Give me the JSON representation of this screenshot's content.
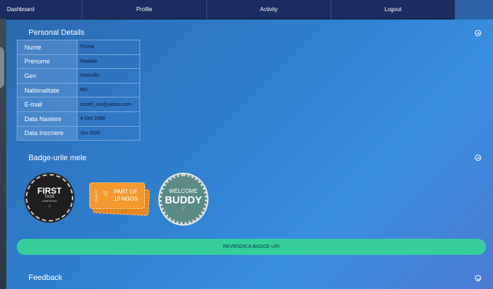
{
  "nav": {
    "items": [
      {
        "label": "Dashboard"
      },
      {
        "label": "Profile"
      },
      {
        "label": "Activity"
      },
      {
        "label": "Logout"
      }
    ]
  },
  "personal": {
    "title": "Personal Details",
    "rows": [
      {
        "key": "Nume",
        "value": "Florea"
      },
      {
        "key": "Prenume",
        "value": "Madalin"
      },
      {
        "key": "Gen",
        "value": "masculin"
      },
      {
        "key": "Nationalitate",
        "value": "RO"
      },
      {
        "key": "E-mail",
        "value": "costel_ark@yahoo.com"
      },
      {
        "key": "Data Nastere",
        "value": "4 Dec 1998"
      },
      {
        "key": "Data Inscriere",
        "value": "Jun 2020"
      }
    ]
  },
  "badges": {
    "title": "Badge-urile mele",
    "first": {
      "line1": "FIRST",
      "line2": "TASK",
      "line3": "COMPLETED"
    },
    "ngo": {
      "line1": "PART OF",
      "line2": "10 NGOS",
      "stub": "20440 03"
    },
    "welcome": {
      "line1": "WELCOME",
      "line2": "BUDDY"
    },
    "claim_label": "REVENDICA BADGE-URI"
  },
  "feedback": {
    "title": "Feedback"
  },
  "colors": {
    "nav_bg": "#1b2c5e",
    "accent_button": "#36cf9a",
    "badge_ngo": "#f29a2e",
    "badge_welcome": "#5c8b86"
  },
  "icons": {
    "collapse": "chevron-up-circle-icon",
    "expand": "chevron-down-circle-icon"
  }
}
